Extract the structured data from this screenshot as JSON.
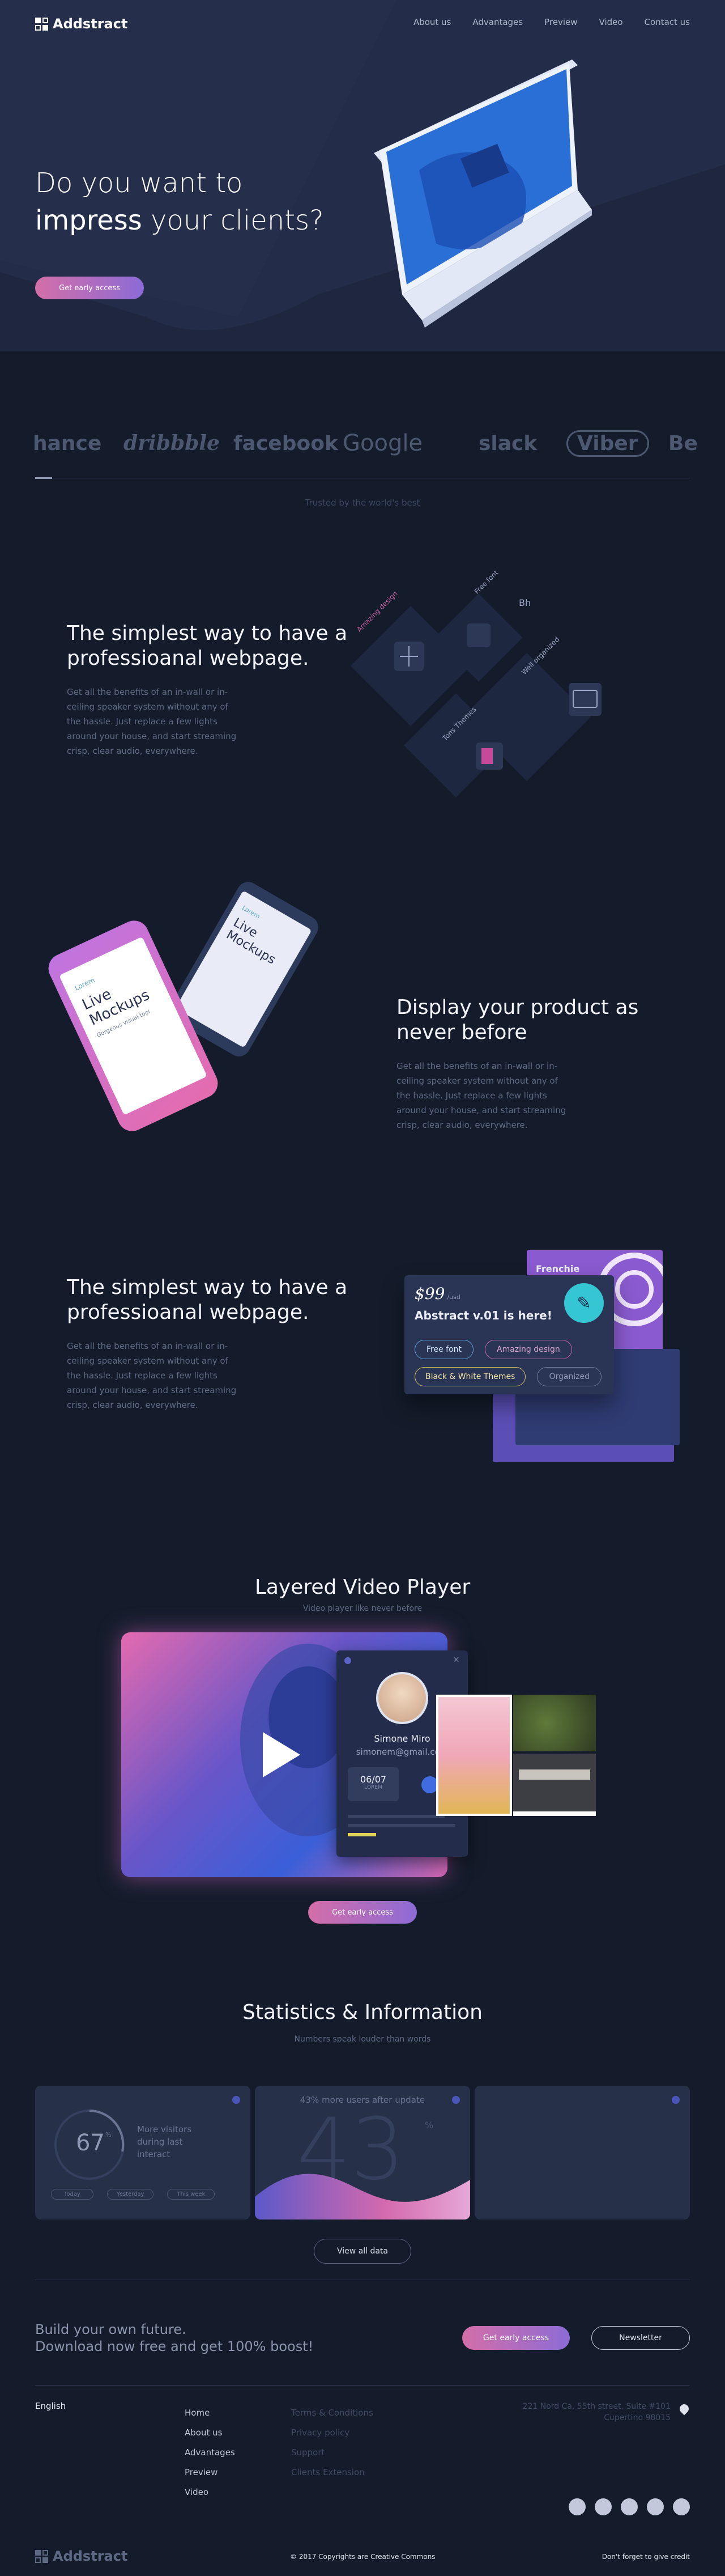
{
  "brand": {
    "name": "Addstract"
  },
  "nav": {
    "items": [
      "About us",
      "Advantages",
      "Preview",
      "Video",
      "Contact us"
    ]
  },
  "hero": {
    "title_line1": "Do you want to",
    "title_strong": "impress",
    "title_rest": " your clients?",
    "cta": "Get early access"
  },
  "logos": {
    "items": [
      "hance",
      "dribbble",
      "facebook",
      "Google",
      "slack",
      "Viber",
      "Be"
    ],
    "caption": "Trusted by the world's best"
  },
  "feature1": {
    "title": "The simplest way to have a professioanal webpage.",
    "body": "Get all the benefits of an in-wall or in-ceiling speaker system without any of the hassle. Just replace a few lights around your house, and start streaming crisp, clear audio, everywhere.",
    "tags": [
      "Amazing design",
      "Free font",
      "Well organized",
      "Tons Themes"
    ],
    "bh": "Bh"
  },
  "feature2": {
    "title": "Display your product as never before",
    "body": "Get all the benefits of an in-wall or in-ceiling speaker system without any of the hassle. Just replace a few lights around your house, and start streaming crisp, clear audio, everywhere.",
    "phone_brand": "Lorem",
    "phone_title": "Live Mockups",
    "phone_sub": "Gorgeous visual tool"
  },
  "feature3": {
    "title": "The simplest way to have a professioanal webpage.",
    "body": "Get all the benefits of an in-wall or in-ceiling speaker system without any of the hassle. Just replace a few lights around your house, and start streaming crisp, clear audio, everywhere.",
    "card_price": "$99",
    "card_price_unit": "/usd",
    "card_title": "Abstract v.01 is here!",
    "chips": [
      "Free font",
      "Amazing design",
      "Black & White Themes",
      "Organized"
    ],
    "back_card_title": "Frenchie"
  },
  "video": {
    "title": "Layered Video Player",
    "subtitle": "Video player like never before",
    "profile_name": "Simone Miro",
    "profile_email": "simonem@gmail.com",
    "stat_value": "06/07",
    "stat_label": "LOREM",
    "cta": "Get early access"
  },
  "stats": {
    "title": "Statistics & Information",
    "subtitle": "Numbers speak louder than words",
    "card1_number": "67",
    "card1_unit": "%",
    "card1_text": "More visitors during last interact",
    "card1_pills": [
      "Today",
      "Yesterday",
      "This week"
    ],
    "card2_title": "43% more users after update",
    "card2_number": "43",
    "card2_unit": "%",
    "view_all": "View all data"
  },
  "cta_band": {
    "line1": "Build your own future.",
    "line2": "Download now free and get 100% boost!",
    "primary": "Get early access",
    "secondary": "Newsletter"
  },
  "footer": {
    "language": "English",
    "links1": [
      "Home",
      "About us",
      "Advantages",
      "Preview",
      "Video"
    ],
    "links2": [
      "Terms & Conditions",
      "Privacy policy",
      "Support",
      "Clients Extension"
    ],
    "address_line1": "221 Nord Ca, 55th street, Suite #101",
    "address_line2": "Cupertino 98015",
    "copyright": "© 2017 Copyrights are Creative Commons",
    "credit": "Don't forget to give credit"
  }
}
